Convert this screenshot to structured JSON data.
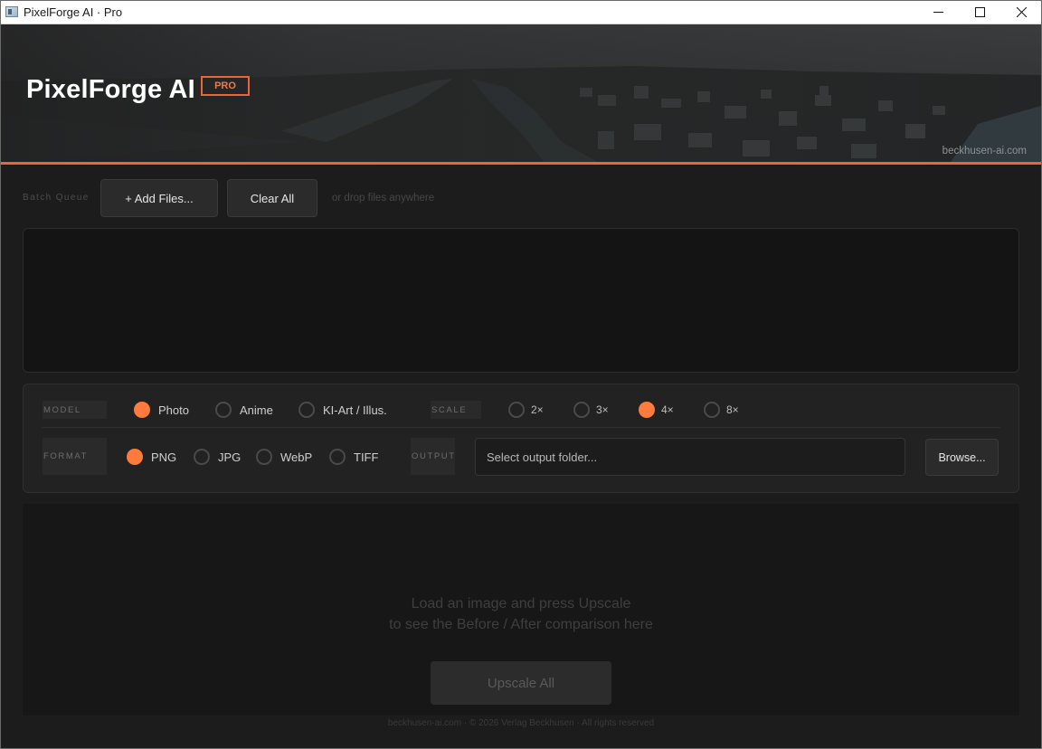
{
  "window": {
    "title": "PixelForge AI · Pro",
    "minimize": "—",
    "maximize": "☐",
    "close": "✕"
  },
  "banner": {
    "title": "PixelForge AI",
    "badge": "PRO",
    "domain": "beckhusen-ai.com",
    "accent_color": "#e8673a"
  },
  "batch": {
    "label": "Batch Queue",
    "add_files": "+ Add Files...",
    "clear_all": "Clear All",
    "drop_hint": "or drop files anywhere"
  },
  "settings": {
    "model": {
      "label": "MODEL",
      "options": [
        {
          "label": "Photo",
          "selected": true
        },
        {
          "label": "Anime",
          "selected": false
        },
        {
          "label": "KI-Art / Illus.",
          "selected": false
        }
      ]
    },
    "scale": {
      "label": "SCALE",
      "options": [
        {
          "label": "2×",
          "selected": false
        },
        {
          "label": "3×",
          "selected": false
        },
        {
          "label": "4×",
          "selected": true
        },
        {
          "label": "8×",
          "selected": false
        }
      ]
    },
    "format": {
      "label": "FORMAT",
      "options": [
        {
          "label": "PNG",
          "selected": true
        },
        {
          "label": "JPG",
          "selected": false
        },
        {
          "label": "WebP",
          "selected": false
        },
        {
          "label": "TIFF",
          "selected": false
        }
      ]
    },
    "output": {
      "label": "OUTPUT",
      "placeholder": "Select output folder...",
      "browse": "Browse..."
    },
    "selected_color": "#ff7a3d"
  },
  "preview": {
    "line1": "Load an image and press Upscale",
    "line2": "to see the Before / After comparison here",
    "upscale_button": "Upscale All"
  },
  "footer": {
    "text": "beckhusen-ai.com  ·  © 2026 Verlag Beckhusen  ·  All rights reserved"
  }
}
